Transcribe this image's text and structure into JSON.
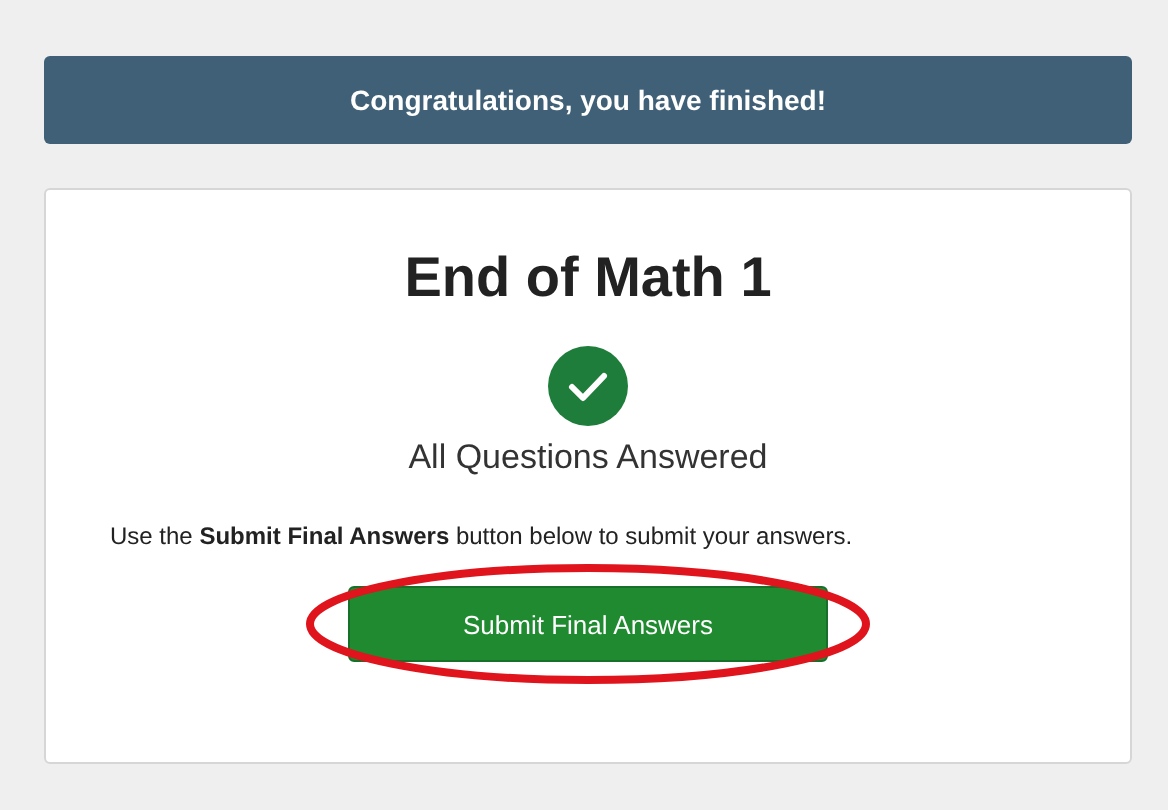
{
  "banner": {
    "text": "Congratulations, you have finished!"
  },
  "card": {
    "title": "End of Math 1",
    "status": "All Questions Answered",
    "instruction": "Use the **Submit Final Answers** button below to submit your answers.",
    "button": {
      "label": "Submit Final Answers",
      "circled": true
    }
  }
}
